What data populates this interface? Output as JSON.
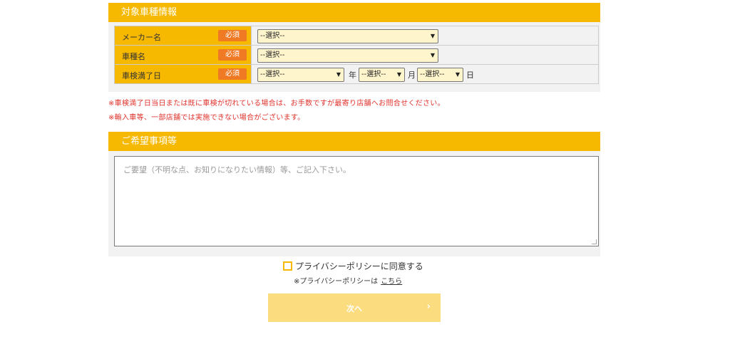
{
  "section1": {
    "title": "対象車種情報",
    "required_label": "必須",
    "rows": [
      {
        "label": "メーカー名",
        "select": "--選択--"
      },
      {
        "label": "車種名",
        "select": "--選択--"
      },
      {
        "label": "車検満了日",
        "year_select": "--選択--",
        "year_unit": "年",
        "month_select": "--選択--",
        "month_unit": "月",
        "day_select": "--選択--",
        "day_unit": "日"
      }
    ]
  },
  "notes": [
    "※車検満了日当日または既に車検が切れている場合は、お手数ですが最寄り店舗へお問合せください。",
    "※輸入車等、一部店舗では実施できない場合がございます。"
  ],
  "section2": {
    "title": "ご希望事項等",
    "textarea_placeholder": "ご要望（不明な点、お知りになりたい情報）等、ご記入下さい。"
  },
  "privacy": {
    "checkbox_label": "プライバシーポリシーに同意する",
    "note_prefix": "※プライバシーポリシーは",
    "link_text": "こちら"
  },
  "next_button": {
    "label": "次へ",
    "icon": "chevron-right-icon"
  },
  "colors": {
    "accent": "#f7b900",
    "required_badge": "#f07a24",
    "note_text": "#e0322b",
    "button_disabled": "#fbdc7e"
  }
}
